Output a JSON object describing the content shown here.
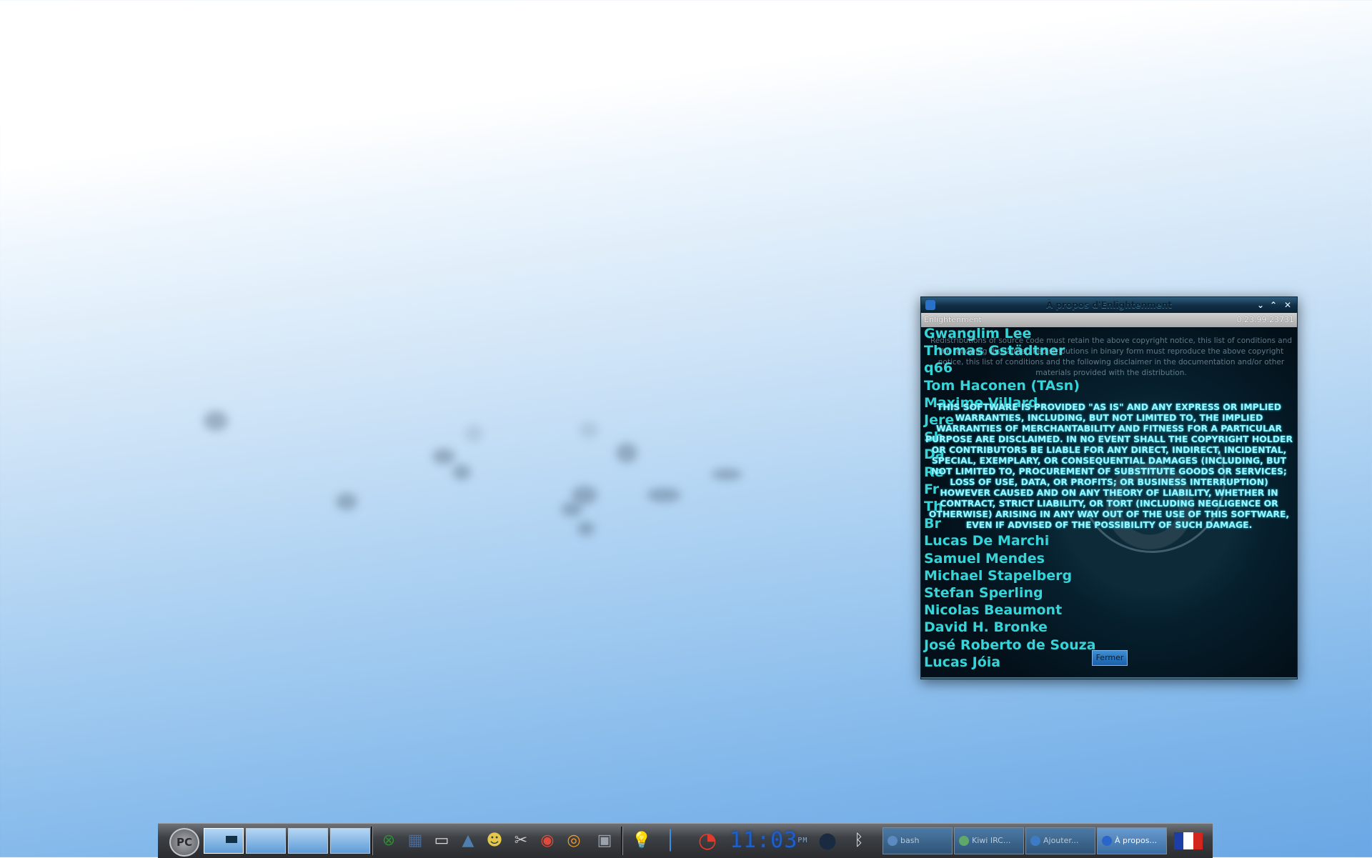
{
  "window": {
    "title": "À propos d'Enlightenment",
    "minimize_glyph": "⌄",
    "maximize_glyph": "⌃",
    "close_glyph": "✕",
    "app_name": "Enlightenment",
    "version": "0.23.99.23731",
    "close_button_label": "Fermer"
  },
  "contributors": [
    "Gwanglim Lee",
    "Thomas Gstädtner",
    "q66",
    "Tom Haconen (TAsn)",
    "Maxime Villard",
    "Jere",
    "Sh",
    "Da",
    "Re",
    "Fr",
    "Th",
    "Br",
    "Lucas De Marchi",
    "Samuel Mendes",
    "Michael Stapelberg",
    "Stefan Sperling",
    "Nicolas Beaumont",
    "David H. Bronke",
    "José Roberto de Souza",
    "Lucas Jóia"
  ],
  "license": {
    "small": "Redistributions of source code must retain the above copyright notice, this list of conditions and the following disclaimer. Redistributions in binary form must reproduce the above copyright notice, this list of conditions and the following disclaimer in the documentation and/or other materials provided with the distribution.",
    "caps": "THIS SOFTWARE IS PROVIDED \"AS IS\" AND ANY EXPRESS OR IMPLIED WARRANTIES, INCLUDING, BUT NOT LIMITED TO, THE IMPLIED WARRANTIES OF MERCHANTABILITY AND FITNESS FOR A PARTICULAR PURPOSE ARE DISCLAIMED. IN NO EVENT SHALL THE COPYRIGHT HOLDER OR CONTRIBUTORS BE LIABLE FOR ANY DIRECT, INDIRECT, INCIDENTAL, SPECIAL, EXEMPLARY, OR CONSEQUENTIAL DAMAGES (INCLUDING, BUT NOT LIMITED TO, PROCUREMENT OF SUBSTITUTE GOODS OR SERVICES; LOSS OF USE, DATA, OR PROFITS; OR BUSINESS INTERRUPTION) HOWEVER CAUSED AND ON ANY THEORY OF LIABILITY, WHETHER IN CONTRACT, STRICT LIABILITY, OR TORT (INCLUDING NEGLIGENCE OR OTHERWISE) ARISING IN ANY WAY OUT OF THE USE OF THIS SOFTWARE, EVEN IF ADVISED OF THE POSSIBILITY OF SUCH DAMAGE."
  },
  "shelf": {
    "start_label": "PC",
    "desktops": 4,
    "active_desktop": 1,
    "launchers": [
      {
        "name": "xbox-launcher-icon",
        "glyph": "⊗",
        "color": "#2e8b34"
      },
      {
        "name": "network-launcher-icon",
        "glyph": "▦",
        "color": "#4a6a9a"
      },
      {
        "name": "terminal-launcher-icon",
        "glyph": "▭",
        "color": "#d9d9d9"
      },
      {
        "name": "file-manager-launcher-icon",
        "glyph": "▲",
        "color": "#4f7fb0"
      },
      {
        "name": "mascot-launcher-icon",
        "glyph": "☻",
        "color": "#e5c84a"
      },
      {
        "name": "settings-launcher-icon",
        "glyph": "✂",
        "color": "#c9c9c9"
      },
      {
        "name": "chrome-launcher-icon",
        "glyph": "◉",
        "color": "#e04a3a"
      },
      {
        "name": "swirl-launcher-icon",
        "glyph": "◎",
        "color": "#f09a2a"
      },
      {
        "name": "screenshot-launcher-icon",
        "glyph": "▣",
        "color": "#9aa3ad"
      }
    ],
    "clock_time": "11:03",
    "clock_ampm": "PM",
    "tasks": [
      {
        "label": "bash",
        "color": "#5b8ac0"
      },
      {
        "label": "Kiwi IRC...",
        "color": "#5fa86a"
      },
      {
        "label": "Ajouter...",
        "color": "#3d7cc4"
      },
      {
        "label": "À propos...",
        "color": "#2a66c9"
      }
    ],
    "active_task": 3,
    "flag_colors": [
      "#1b3fa6",
      "#ffffff",
      "#d4241e"
    ]
  }
}
